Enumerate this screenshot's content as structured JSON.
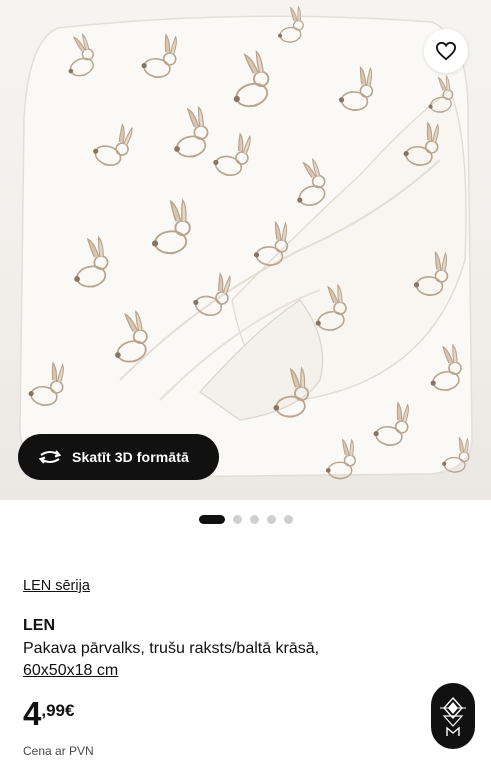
{
  "hero": {
    "image_name": "bunny-print-pillowcase-photo",
    "favorite_icon": "heart-icon",
    "view_3d_label": "Skatīt 3D formātā",
    "view_3d_icon": "rotate-arrows-icon"
  },
  "carousel": {
    "total": 5,
    "active_index": 0
  },
  "product": {
    "series_link": "LEN sērija",
    "name": "LEN",
    "description": "Pakava pārvalks, trušu raksts/baltā krāsā,",
    "size": "60x50x18 cm",
    "price_main": "4",
    "price_decimals": ",99€",
    "price_note": "Cena ar PVN"
  },
  "badge": {
    "icon": "diamond-logo-icon"
  },
  "colors": {
    "text": "#111111",
    "button_dark": "#111111",
    "dot_inactive": "#cfcfcf",
    "fabric": "#fbf9f5",
    "print": "#c9b7a2"
  }
}
